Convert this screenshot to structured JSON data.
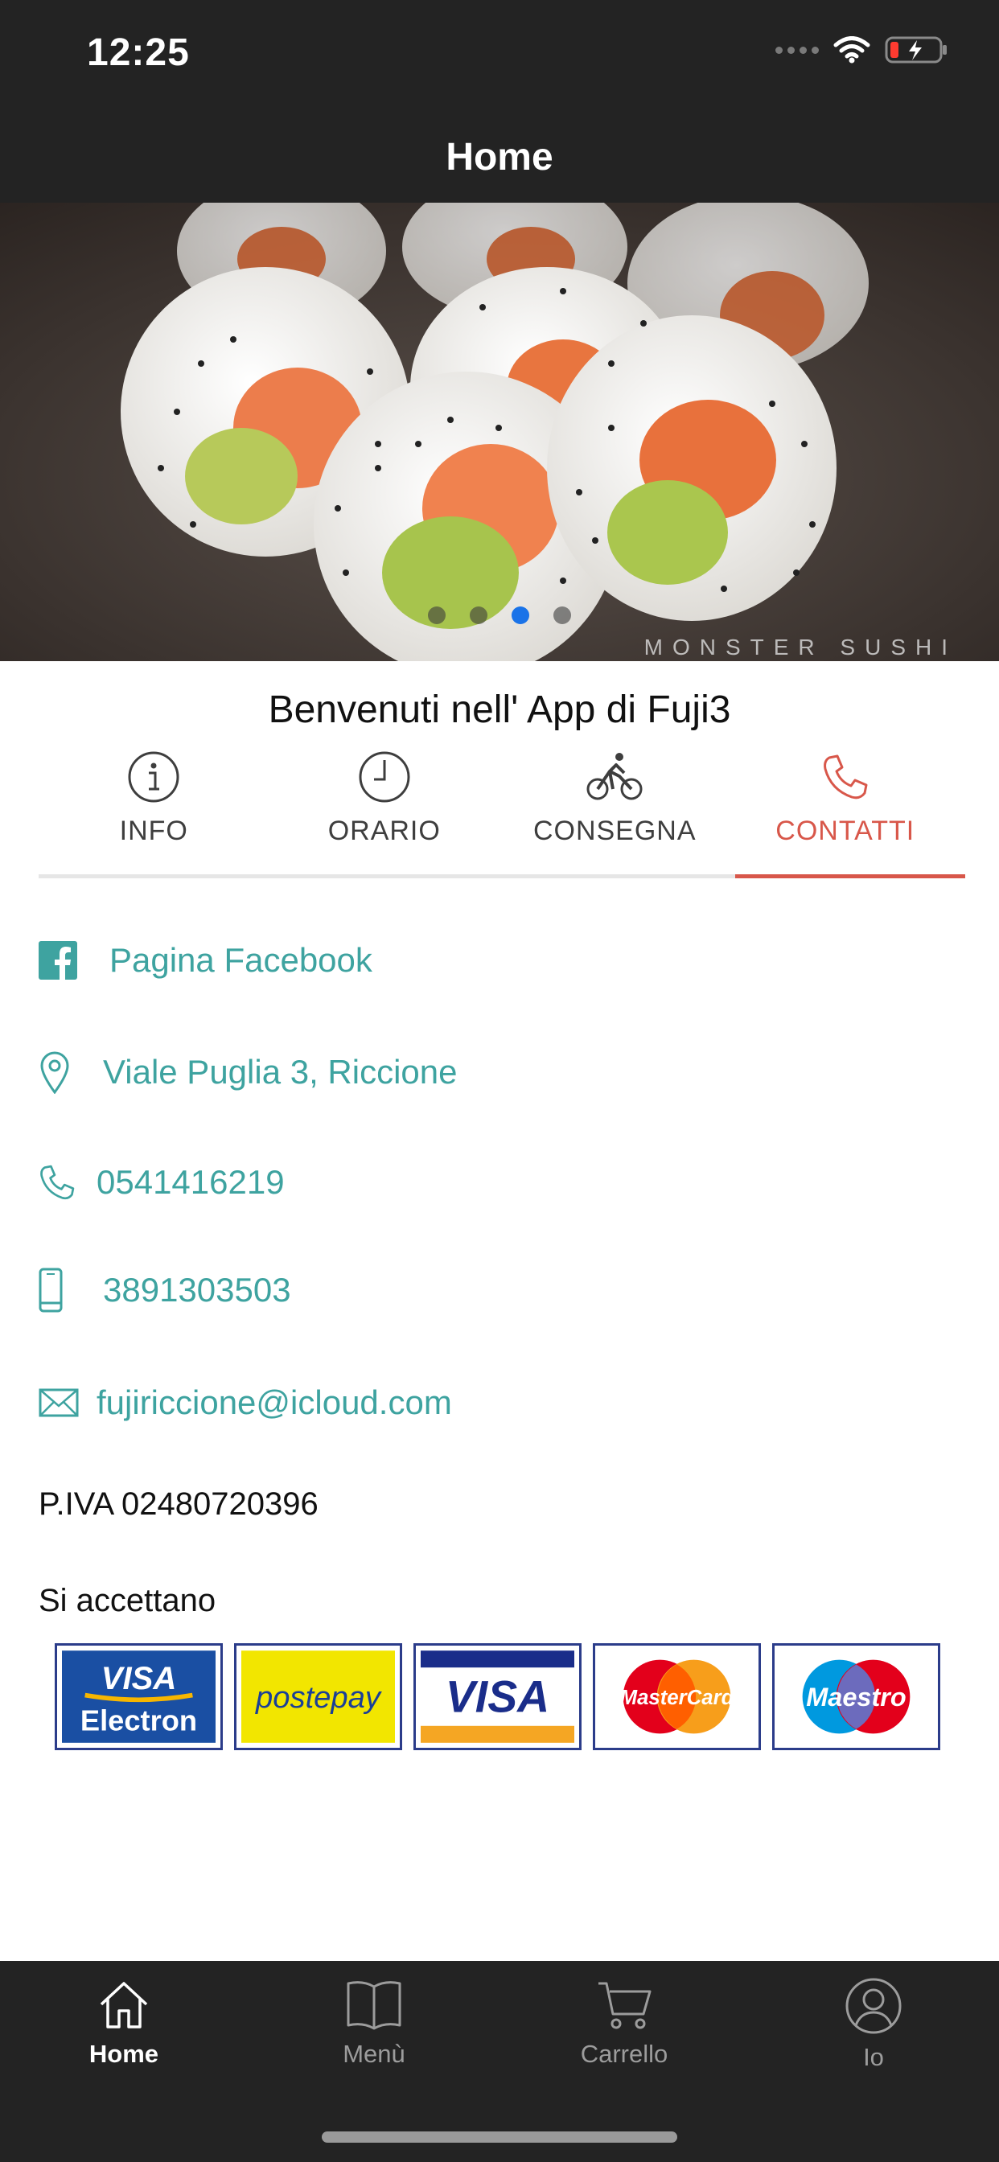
{
  "status": {
    "time": "12:25"
  },
  "nav": {
    "title": "Home"
  },
  "welcome": "Benvenuti nell' App di Fuji3",
  "hero": {
    "watermark": "MONSTER SUSHI"
  },
  "tabs": [
    {
      "label": "INFO",
      "icon": "info-icon"
    },
    {
      "label": "ORARIO",
      "icon": "clock-icon"
    },
    {
      "label": "CONSEGNA",
      "icon": "bicycle-icon"
    },
    {
      "label": "CONTATTI",
      "icon": "phone-icon"
    }
  ],
  "active_tab": "CONTATTI",
  "contacts": {
    "facebook": "Pagina Facebook",
    "address": "Viale Puglia 3, Riccione",
    "phone": "0541416219",
    "mobile": "3891303503",
    "email": "fujiriccione@icloud.com"
  },
  "piva": "P.IVA 02480720396",
  "payments_title": "Si accettano",
  "payments": {
    "visa_electron_line1": "VISA",
    "visa_electron_line2": "Electron",
    "postepay": "postepay",
    "visa": "VISA",
    "mastercard": "MasterCard",
    "maestro": "Maestro"
  },
  "bottom_tabs": [
    {
      "label": "Home",
      "icon": "home-icon"
    },
    {
      "label": "Menù",
      "icon": "book-icon"
    },
    {
      "label": "Carrello",
      "icon": "cart-icon"
    },
    {
      "label": "Io",
      "icon": "user-icon"
    }
  ],
  "colors": {
    "accent": "#d8574a",
    "link": "#3ea3a0",
    "bar": "#232323",
    "page_indicator_active": "#1a73e8"
  }
}
